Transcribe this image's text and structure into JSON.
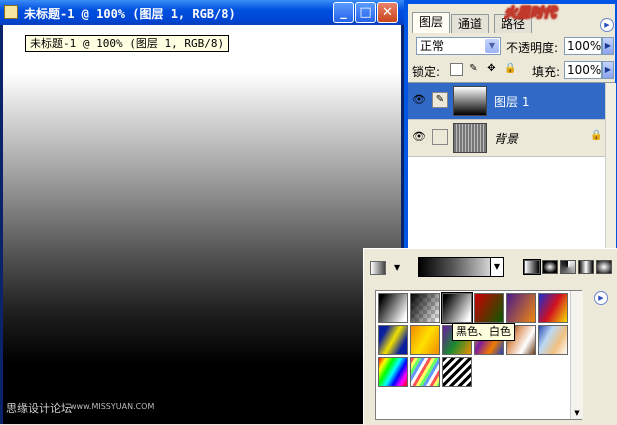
{
  "document": {
    "title": "未标题-1 @ 100% (图层 1, RGB/8)",
    "tooltip": "未标题-1 @ 100% (图层 1, RGB/8)",
    "controls": {
      "minimize": "_",
      "maximize": "□",
      "close": "✕"
    }
  },
  "watermark": {
    "text": "思缘设计论坛",
    "url": "www.MISSYUAN.COM"
  },
  "layers_panel": {
    "tabs": [
      {
        "label": "图层"
      },
      {
        "label": "通道"
      },
      {
        "label": "路径"
      }
    ],
    "blend_mode": "正常",
    "opacity_label": "不透明度:",
    "opacity_value": "100%",
    "lock_label": "锁定:",
    "fill_label": "填充:",
    "fill_value": "100%",
    "layers": [
      {
        "name": "图层 1",
        "selected": true
      },
      {
        "name": "背景",
        "locked": true
      }
    ]
  },
  "gradient_picker": {
    "tooltip": "黑色、白色",
    "types": [
      "linear",
      "radial",
      "angle",
      "reflected",
      "diamond"
    ],
    "swatches": [
      "fg-bg",
      "fg-transparent",
      "black-white",
      "red-green",
      "violet-orange",
      "blue-red-yellow",
      "blue-yellow-blue",
      "orange-yellow-orange",
      "violet-green-orange",
      "yellow-violet-orange-blue",
      "copper",
      "chrome",
      "spectrum",
      "transparent-rainbow",
      "transparent-stripes"
    ]
  },
  "colors": {
    "titlebar": "#0050e0",
    "selection": "#3169c6",
    "panel_bg": "#ece9d8"
  }
}
